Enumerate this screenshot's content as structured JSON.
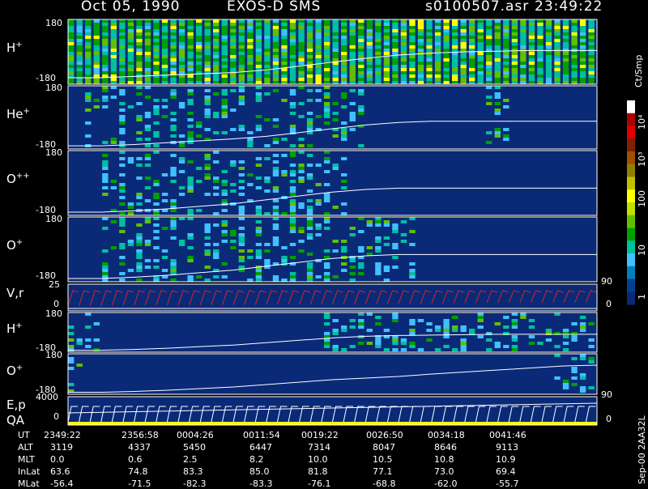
{
  "header": {
    "date": "Oct 05, 1990",
    "instrument": "EXOS-D SMS",
    "file": "s0100507.asr",
    "time": "23:49:22"
  },
  "colorbar": {
    "unit": "Ct/Smp",
    "labels": [
      "10⁴",
      "10³",
      "100",
      "10",
      "1"
    ],
    "colors": [
      "#ffffff",
      "#b00000",
      "#e00000",
      "#802000",
      "#a05000",
      "#908000",
      "#c0c000",
      "#ffff00",
      "#c0e000",
      "#60c000",
      "#00a000",
      "#00c0a0",
      "#40c0ff",
      "#0080c0",
      "#004090",
      "#0a2a78"
    ]
  },
  "chart_data": [
    {
      "type": "heatmap",
      "panel": "H+",
      "ylabel": "H+",
      "yticks": [
        "180",
        "-180"
      ],
      "trace": [
        0.9,
        0.9,
        0.88,
        0.86,
        0.84,
        0.82,
        0.78,
        0.72,
        0.66,
        0.6,
        0.55,
        0.52,
        0.5,
        0.49,
        0.48,
        0.48,
        0.48
      ]
    },
    {
      "type": "heatmap",
      "panel": "He+",
      "ylabel": "He+",
      "yticks": [
        "180",
        "-180"
      ],
      "trace": [
        0.95,
        0.95,
        0.93,
        0.9,
        0.87,
        0.84,
        0.8,
        0.74,
        0.68,
        0.62,
        0.58,
        0.56,
        0.56,
        0.56,
        0.56,
        0.56,
        0.56
      ]
    },
    {
      "type": "heatmap",
      "panel": "O++",
      "ylabel": "O++",
      "yticks": [
        "180",
        "-180"
      ],
      "trace": [
        0.95,
        0.95,
        0.93,
        0.9,
        0.86,
        0.82,
        0.76,
        0.7,
        0.64,
        0.6,
        0.58,
        0.58,
        0.58,
        0.58,
        0.58,
        0.58,
        0.58
      ]
    },
    {
      "type": "heatmap",
      "panel": "O+",
      "ylabel": "O+",
      "yticks": [
        "180",
        "-180"
      ],
      "right_tick": "90",
      "trace": [
        0.95,
        0.95,
        0.93,
        0.9,
        0.86,
        0.82,
        0.76,
        0.7,
        0.64,
        0.6,
        0.58,
        0.58,
        0.58,
        0.58,
        0.58,
        0.58,
        0.58
      ]
    },
    {
      "type": "line",
      "panel": "V,r",
      "ylabel": "V,r",
      "yticks": [
        "25",
        "0"
      ],
      "right_tick": "0"
    },
    {
      "type": "heatmap",
      "panel": "H+ (2)",
      "ylabel": "H+",
      "yticks": [
        "180",
        "-180"
      ],
      "trace": [
        0.95,
        0.95,
        0.93,
        0.9,
        0.86,
        0.82,
        0.76,
        0.7,
        0.64,
        0.6,
        0.58,
        0.57,
        0.56,
        0.55,
        0.55,
        0.55,
        0.55
      ]
    },
    {
      "type": "heatmap",
      "panel": "O+ (2)",
      "ylabel": "O+",
      "yticks": [
        "180",
        "-180"
      ],
      "right_tick": "90",
      "trace": [
        0.95,
        0.95,
        0.93,
        0.9,
        0.86,
        0.82,
        0.76,
        0.7,
        0.64,
        0.6,
        0.56,
        0.5,
        0.45,
        0.4,
        0.35,
        0.3,
        0.28
      ]
    },
    {
      "type": "line",
      "panel": "E,p QA",
      "ylabel": "E,p",
      "ylabel2": "QA",
      "yticks": [
        "4000",
        "0"
      ],
      "right_tick": "0"
    }
  ],
  "ephemeris": {
    "row_labels": [
      "UT",
      "ALT",
      "MLT",
      "InLat",
      "MLat"
    ],
    "columns": [
      {
        "UT": "2349:22",
        "ALT": "3119",
        "MLT": "0.0",
        "InLat": "63.6",
        "MLat": "-56.4"
      },
      {
        "UT": "2356:58",
        "ALT": "4337",
        "MLT": "0.6",
        "InLat": "74.8",
        "MLat": "-71.5"
      },
      {
        "UT": "0004:26",
        "ALT": "5450",
        "MLT": "2.5",
        "InLat": "83.3",
        "MLat": "-82.3"
      },
      {
        "UT": "0011:54",
        "ALT": "6447",
        "MLT": "8.2",
        "InLat": "85.0",
        "MLat": "-83.3"
      },
      {
        "UT": "0019:22",
        "ALT": "7314",
        "MLT": "10.0",
        "InLat": "81.8",
        "MLat": "-76.1"
      },
      {
        "UT": "0026:50",
        "ALT": "8047",
        "MLT": "10.5",
        "InLat": "77.1",
        "MLat": "-68.8"
      },
      {
        "UT": "0034:18",
        "ALT": "8646",
        "MLT": "10.8",
        "InLat": "73.0",
        "MLat": "-62.0"
      },
      {
        "UT": "0041:46",
        "ALT": "9113",
        "MLT": "10.9",
        "InLat": "69.4",
        "MLat": "-55.7"
      }
    ]
  },
  "footer_stamp": "Sep-00 2AA32L"
}
